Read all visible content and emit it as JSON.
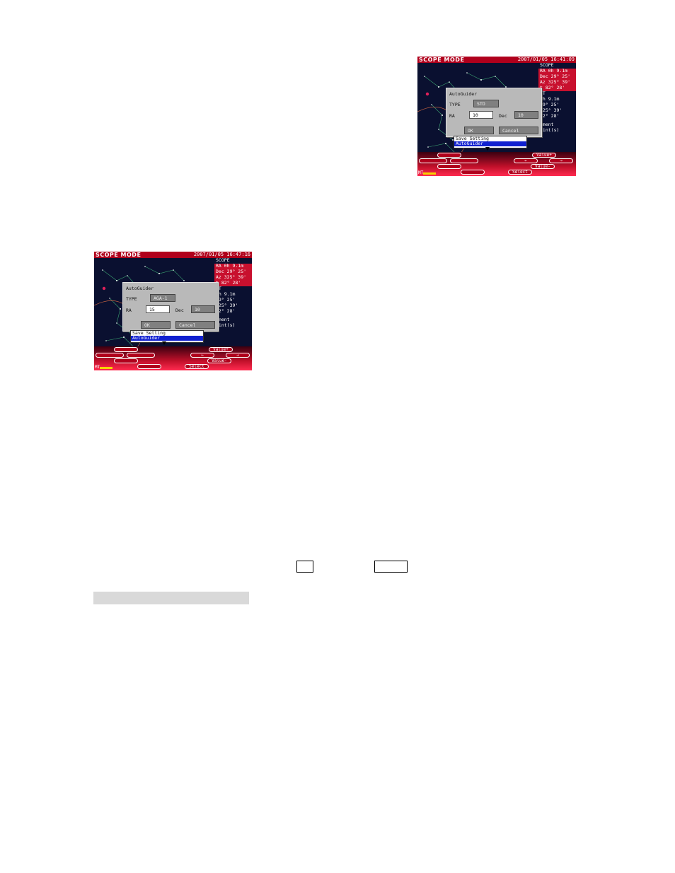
{
  "screens": [
    {
      "mode_title": "SCOPE MODE",
      "clock": "2007/01/05 16:41:09",
      "panel": {
        "header": "SCOPE",
        "ra": "RA  0h 9.1m",
        "dec": "Dec 29° 25'",
        "az": "Az 325° 39'",
        "alt": "t 82° 28'",
        "target_header": "ET",
        "t_ra": "0h 9.1m",
        "t_dec": "29° 25'",
        "t_az": "325° 39'",
        "t_alt": "82° 28'",
        "align1": "nment",
        "align2": "oint(s)"
      },
      "dialog": {
        "title": "AutoGuider",
        "type_label": "TYPE",
        "type_value": "STD",
        "ra_label": "RA",
        "ra_value": "10",
        "dec_label": "Dec",
        "dec_value": "10",
        "ok_label": "OK",
        "cancel_label": "Cancel"
      },
      "menu": [
        "Save Setting",
        "AutoGuider"
      ],
      "buttons": {
        "value_plus": "Value+",
        "value_minus": "Value-",
        "left": "←",
        "right": "→",
        "select": "Select"
      },
      "mt": "MT"
    },
    {
      "mode_title": "SCOPE MODE",
      "clock": "2007/01/05 16:47:16",
      "panel": {
        "header": "SCOPE",
        "ra": "RA  0h 9.1m",
        "dec": "Dec 29° 25'",
        "az": "Az 325° 39'",
        "alt": "t 82° 28'",
        "target_header": "ET",
        "t_ra": "0h 9.1m",
        "t_dec": "29° 25'",
        "t_az": "325° 39'",
        "t_alt": "82° 28'",
        "align1": "nment",
        "align2": "oint(s)"
      },
      "dialog": {
        "title": "AutoGuider",
        "type_label": "TYPE",
        "type_value": "AGA-1",
        "ra_label": "RA",
        "ra_value": "15",
        "dec_label": "Dec",
        "dec_value": "10",
        "ok_label": "OK",
        "cancel_label": "Cancel"
      },
      "menu": [
        "Save Setting",
        "AutoGuider"
      ],
      "buttons": {
        "value_plus": "Value+",
        "value_minus": "Value-",
        "left": "←",
        "right": "→",
        "select": "Select"
      },
      "mt": "MT"
    }
  ]
}
